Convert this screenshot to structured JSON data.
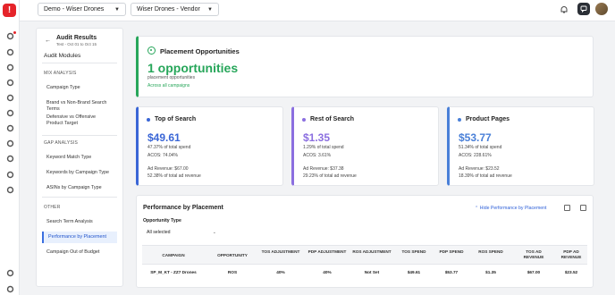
{
  "app": {
    "logo_letter": "!",
    "expand_glyph": "›",
    "rail_icons": [
      "megaphone-icon",
      "users-icon",
      "clock-icon",
      "grid-icon",
      "layers-icon",
      "share-icon",
      "search-doc-icon",
      "settings-star-icon",
      "wand-icon",
      "copyright-icon",
      "globe-icon",
      "account-icon",
      "gear-icon"
    ]
  },
  "topbar": {
    "account_select": "Demo - Wiser Drones",
    "profile_select": "Wiser Drones - Vendor"
  },
  "subnav": {
    "title": "Audit Results",
    "date_range": "Test - Oct 01 to Oct 15",
    "heading": "Audit Modules",
    "sections": [
      {
        "label": "MIX ANALYSIS",
        "items": [
          "Campaign Type",
          "Brand vs Non-Brand Search Terms",
          "Defensive vs Offensive Product Target"
        ]
      },
      {
        "label": "GAP ANALYSIS",
        "items": [
          "Keyword Match Type",
          "Keywords by Campaign Type",
          "ASINs by Campaign Type"
        ]
      },
      {
        "label": "OTHER",
        "items": [
          "Search Term Analysis",
          "Performance by Placement",
          "Campaign Out of Budget"
        ]
      }
    ],
    "active_item": "Performance by Placement"
  },
  "opportunities": {
    "title": "Placement Opportunities",
    "count": "1 opportunities",
    "subtitle": "placement opportunities",
    "link": "Across all campaigns",
    "accent": "#27a65a"
  },
  "placements": [
    {
      "title": "Top of Search",
      "value": "$49.61",
      "pct_spend": "47.37% of total spend",
      "acos": "ACOS: 74.04%",
      "ad_revenue": "Ad Revenue: $67.00",
      "pct_revenue": "52.38% of total ad revenue",
      "color": "#3a66d6"
    },
    {
      "title": "Rest of Search",
      "value": "$1.35",
      "pct_spend": "1.29% of total spend",
      "acos": "ACOS: 3.61%",
      "ad_revenue": "Ad Revenue: $37.38",
      "pct_revenue": "29.23% of total ad revenue",
      "color": "#8b6fe0"
    },
    {
      "title": "Product Pages",
      "value": "$53.77",
      "pct_spend": "51.34% of total spend",
      "acos": "ACOS: 228.61%",
      "ad_revenue": "Ad Revenue: $23.52",
      "pct_revenue": "18.39% of total ad revenue",
      "color": "#4a80d8"
    }
  ],
  "performance": {
    "title": "Performance by Placement",
    "hide_link": "Hide Performance by Placement",
    "filter_label": "Opportunity Type",
    "filter_value": "All selected",
    "columns": [
      "CAMPAIGN",
      "OPPORTUNITY",
      "TOS ADJUSTMENT",
      "PDP ADJUSTMENT",
      "ROS ADJUSTMENT",
      "TOS SPEND",
      "PDP SPEND",
      "ROS SPEND",
      "TOS AD REVENUE",
      "PDP AD REVENUE"
    ],
    "rows": [
      [
        "SP_M_KT - ZZ7 Drones",
        "ROS",
        "40%",
        "40%",
        "Not Set",
        "$49.61",
        "$53.77",
        "$1.35",
        "$67.00",
        "$23.52"
      ]
    ]
  }
}
